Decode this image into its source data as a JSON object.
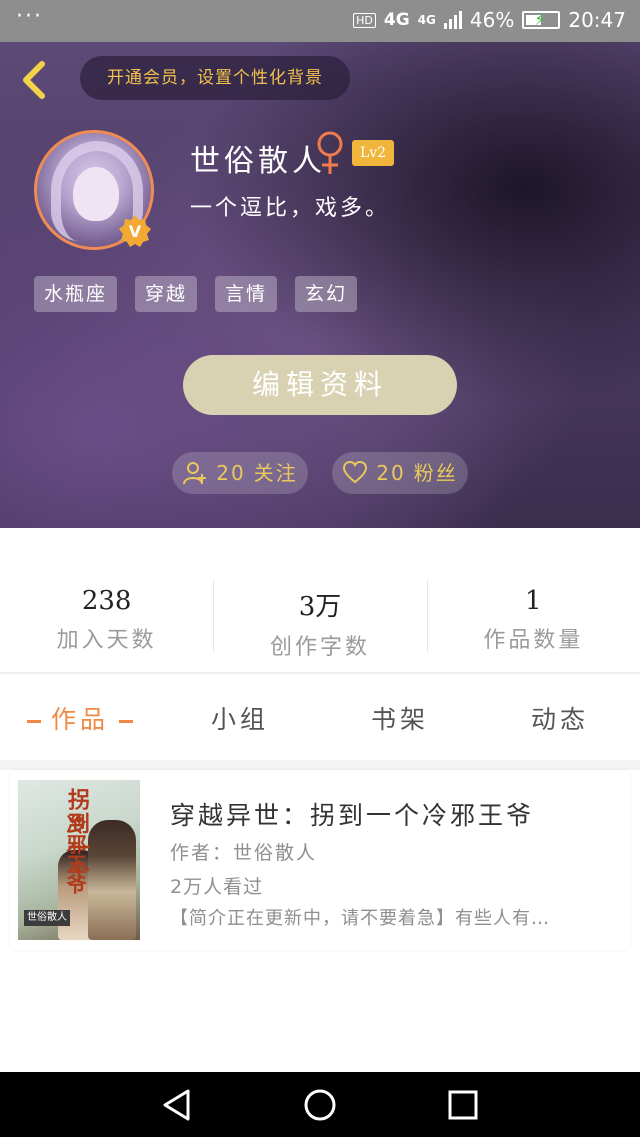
{
  "status_bar": {
    "dots": "···",
    "hd": "HD",
    "network": "4G",
    "network2": "4G",
    "battery_percent": "46%",
    "time": "20:47"
  },
  "header": {
    "vip_banner": "开通会员，设置个性化背景",
    "username": "世俗散人",
    "gender_symbol": "♀",
    "level": "Lv2",
    "signature": "一个逗比，戏多。",
    "tags": [
      "水瓶座",
      "穿越",
      "言情",
      "玄幻"
    ],
    "edit_button": "编辑资料",
    "follow": {
      "count": "20",
      "label": "关注"
    },
    "fans": {
      "count": "20",
      "label": "粉丝"
    }
  },
  "stats": [
    {
      "value": "238",
      "label": "加入天数"
    },
    {
      "value": "3万",
      "label": "创作字数"
    },
    {
      "value": "1",
      "label": "作品数量"
    }
  ],
  "tabs": [
    "作品",
    "小组",
    "书架",
    "动态"
  ],
  "book": {
    "cover_title": "拐到一个",
    "cover_title2": "冷邪王爷",
    "cover_author": "世俗散人",
    "title": "穿越异世：拐到一个冷邪王爷",
    "author": "作者：世俗散人",
    "views": "2万人看过",
    "intro": "【简介正在更新中，请不要着急】有些人有…"
  },
  "colors": {
    "accent": "#ef8a45",
    "gold": "#e9c95a",
    "header_bg": "#4e3d66"
  }
}
